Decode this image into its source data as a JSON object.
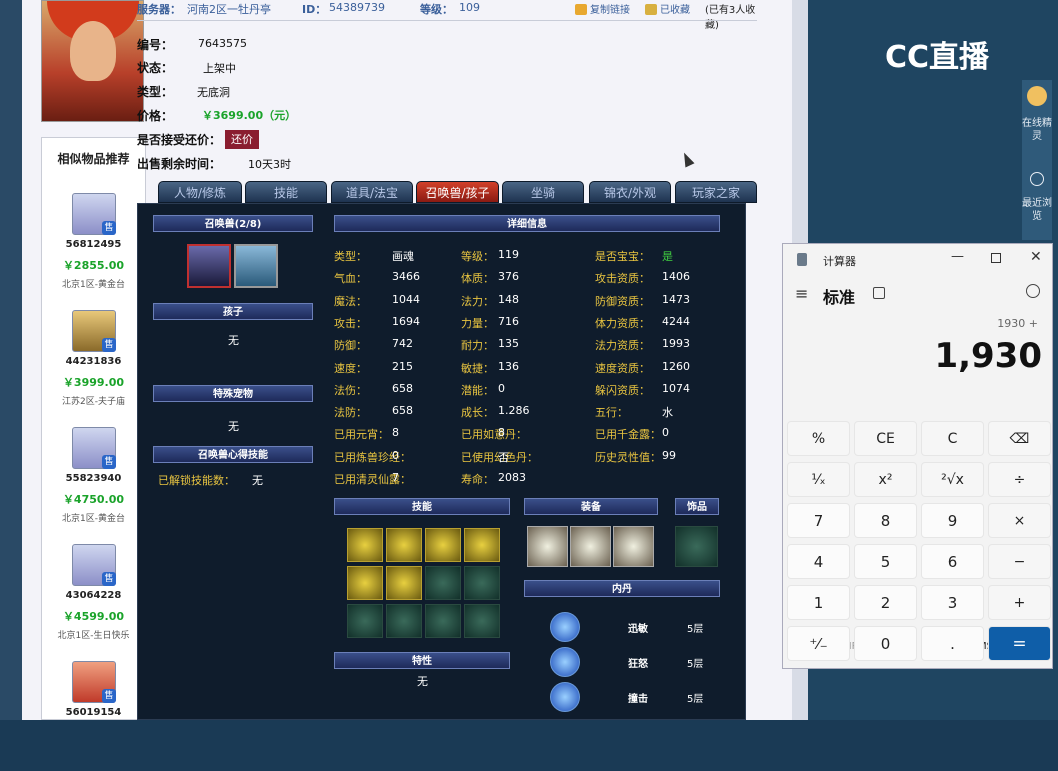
{
  "top": {
    "server_label": "服务器：",
    "server_value": "河南2区一牡丹亭",
    "id_label": "ID：",
    "id_value": "54389739",
    "level_label": "等级：",
    "level_value": "109",
    "copy_link": "复制链接",
    "favorited": "已收藏",
    "fav_count": "(已有3人收藏)"
  },
  "info": {
    "code_label": "编号：",
    "code_value": "7643575",
    "status_label": "状态：",
    "status_value": "上架中",
    "type_label": "类型：",
    "type_value": "无底洞",
    "price_label": "价格：",
    "price_value": "￥3699.00（元）",
    "bargain_label": "是否接受还价：",
    "bargain_button": "还价",
    "time_label": "出售剩余时间：",
    "time_value": "10天3时"
  },
  "similar": {
    "title": "相似物品推荐",
    "items": [
      {
        "id": "56812495",
        "price": "￥2855.00",
        "server": "北京1区-黄金台",
        "tag": "售",
        "style": "blue"
      },
      {
        "id": "44231836",
        "price": "￥3999.00",
        "server": "江苏2区-夫子庙",
        "tag": "售",
        "style": "gold"
      },
      {
        "id": "55823940",
        "price": "￥4750.00",
        "server": "北京1区-黄金台",
        "tag": "售",
        "style": "blue"
      },
      {
        "id": "43064228",
        "price": "￥4599.00",
        "server": "北京1区-生日快乐",
        "tag": "售",
        "style": "blue"
      },
      {
        "id": "56019154",
        "price": "",
        "server": "",
        "tag": "售",
        "style": "red"
      }
    ]
  },
  "tabs": [
    "人物/修炼",
    "技能",
    "道具/法宝",
    "召唤兽/孩子",
    "坐骑",
    "锦衣/外观",
    "玩家之家"
  ],
  "game": {
    "pet_header": "召唤兽(2/8)",
    "child_header": "孩子",
    "child_value": "无",
    "special_header": "特殊宠物",
    "special_value": "无",
    "heart_header": "召唤兽心得技能",
    "unlock_label": "已解锁技能数：",
    "unlock_value": "无",
    "detail_header": "详细信息",
    "col1": [
      {
        "k": "类型：",
        "v": "画魂"
      },
      {
        "k": "气血：",
        "v": "3466"
      },
      {
        "k": "魔法：",
        "v": "1044"
      },
      {
        "k": "攻击：",
        "v": "1694"
      },
      {
        "k": "防御：",
        "v": "742"
      },
      {
        "k": "速度：",
        "v": "215"
      },
      {
        "k": "法伤：",
        "v": "658"
      },
      {
        "k": "法防：",
        "v": "658"
      },
      {
        "k": "已用元宵：",
        "v": "8"
      },
      {
        "k": "已用炼兽珍经：",
        "v": "0"
      },
      {
        "k": "已用清灵仙露：",
        "v": "7"
      }
    ],
    "col2": [
      {
        "k": "等级：",
        "v": "119"
      },
      {
        "k": "体质：",
        "v": "376"
      },
      {
        "k": "法力：",
        "v": "148"
      },
      {
        "k": "力量：",
        "v": "716"
      },
      {
        "k": "耐力：",
        "v": "135"
      },
      {
        "k": "敏捷：",
        "v": "136"
      },
      {
        "k": "潜能：",
        "v": "0"
      },
      {
        "k": "成长：",
        "v": "1.286"
      },
      {
        "k": "已用如意丹：",
        "v": "8"
      },
      {
        "k": "已使用幻色丹：",
        "v": "否"
      },
      {
        "k": "寿命：",
        "v": "2083"
      }
    ],
    "col3": [
      {
        "k": "是否宝宝：",
        "v": "是"
      },
      {
        "k": "攻击资质：",
        "v": "1406"
      },
      {
        "k": "防御资质：",
        "v": "1473"
      },
      {
        "k": "体力资质：",
        "v": "4244"
      },
      {
        "k": "法力资质：",
        "v": "1993"
      },
      {
        "k": "速度资质：",
        "v": "1260"
      },
      {
        "k": "躲闪资质：",
        "v": "1074"
      },
      {
        "k": "五行：",
        "v": "水"
      },
      {
        "k": "已用千金露：",
        "v": "0"
      },
      {
        "k": "历史灵性值：",
        "v": "99"
      }
    ],
    "skill_header": "技能",
    "equip_header": "装备",
    "accessory_header": "饰品",
    "neidan_header": "内丹",
    "trait_header": "特性",
    "trait_value": "无",
    "neidan": [
      {
        "name": "迅敏",
        "level": "5层"
      },
      {
        "name": "狂怒",
        "level": "5层"
      },
      {
        "name": "撞击",
        "level": "5层"
      }
    ]
  },
  "cc": {
    "logo": "CC直播",
    "online": "在线精灵",
    "recent": "最近浏览"
  },
  "calculator": {
    "title": "计算器",
    "mode": "标准",
    "expression": "1930 +",
    "display": "1,930",
    "memory": [
      "MC",
      "MR",
      "M+",
      "M−",
      "MS",
      "M▾"
    ],
    "rows": [
      [
        "%",
        "CE",
        "C",
        "⌫"
      ],
      [
        "¹⁄ₓ",
        "x²",
        "²√x",
        "÷"
      ],
      [
        "7",
        "8",
        "9",
        "×"
      ],
      [
        "4",
        "5",
        "6",
        "−"
      ],
      [
        "1",
        "2",
        "3",
        "+"
      ],
      [
        "⁺⁄₋",
        "0",
        ".",
        "="
      ]
    ]
  }
}
